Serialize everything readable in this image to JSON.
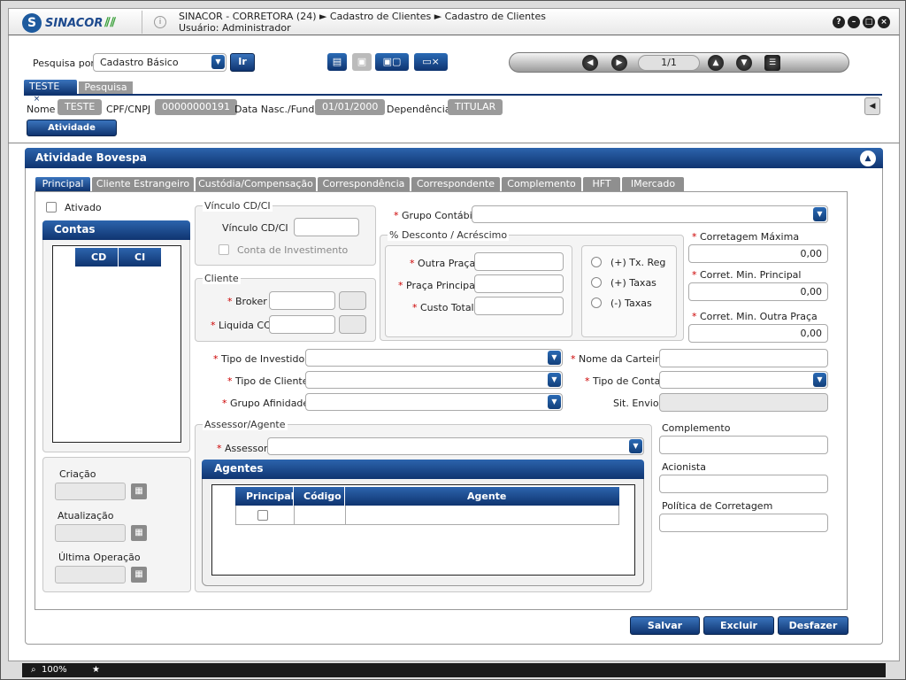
{
  "titlebar": {
    "logo": "SINACOR",
    "line1": "SINACOR - CORRETORA (24) ► Cadastro de Clientes ► Cadastro de Clientes",
    "line2": "Usuário: Administrador",
    "buttons": [
      "?",
      "–",
      "□",
      "×"
    ]
  },
  "search": {
    "label": "Pesquisa por",
    "value": "Cadastro Básico",
    "go_label": "Ir"
  },
  "pager": {
    "value": "1/1"
  },
  "doc_tabs": [
    {
      "label": "TESTE"
    },
    {
      "label": "Pesquisa"
    }
  ],
  "summary": {
    "nome_label": "Nome",
    "nome": "TESTE",
    "cpf_label": "CPF/CNPJ",
    "cpf": "00000000191",
    "nasc_label": "Data Nasc./Fund.",
    "nasc": "01/01/2000",
    "dep_label": "Dependência",
    "dep": "TITULAR"
  },
  "atividade_button": "Atividade Bovespa",
  "panel_title": "Atividade Bovespa",
  "tabs": [
    {
      "label": "Principal"
    },
    {
      "label": "Cliente Estrangeiro"
    },
    {
      "label": "Custódia/Compensação"
    },
    {
      "label": "Correspondência"
    },
    {
      "label": "Correspondente"
    },
    {
      "label": "Complemento"
    },
    {
      "label": "HFT"
    },
    {
      "label": "IMercado"
    }
  ],
  "form": {
    "ativado": "Ativado",
    "contas": "Contas",
    "contas_cols": [
      "CD",
      "CI"
    ],
    "vinculo_title": "Vínculo CD/CI",
    "vinculo_label": "Vínculo CD/CI",
    "conta_invest": "Conta de Investimento",
    "cliente_title": "Cliente",
    "broker": "Broker",
    "liquida": "Liquida CC",
    "grupo_contabil": "Grupo Contábil",
    "desconto_title": "% Desconto / Acréscimo",
    "outra_praca": "Outra Praça",
    "praca_principal": "Praça Principal",
    "custo_total": "Custo Total",
    "radios": [
      "(+) Tx. Reg",
      "(+) Taxas",
      "(-) Taxas"
    ],
    "corretagem_max": "Corretagem Máxima",
    "corretagem_max_val": "0,00",
    "corret_min_principal": "Corret. Min. Principal",
    "corret_min_principal_val": "0,00",
    "corret_min_outra": "Corret. Min. Outra Praça",
    "corret_min_outra_val": "0,00",
    "tipo_investidor": "Tipo de Investidor",
    "tipo_cliente": "Tipo de Cliente",
    "grupo_afinidade": "Grupo Afinidade",
    "nome_carteira": "Nome da Carteira",
    "tipo_conta": "Tipo de Conta",
    "sit_envio": "Sit. Envio",
    "assessor_title": "Assessor/Agente",
    "assessor": "Assessor",
    "agentes": "Agentes",
    "agentes_cols": [
      "Principal",
      "Código",
      "Agente"
    ],
    "complemento": "Complemento",
    "acionista": "Acionista",
    "politica": "Política de Corretagem",
    "criacao": "Criação",
    "atualizacao": "Atualização",
    "ultima_operacao": "Última Operação"
  },
  "actions": {
    "salvar": "Salvar",
    "excluir": "Excluir",
    "desfazer": "Desfazer"
  },
  "status": {
    "zoom": "100%"
  }
}
